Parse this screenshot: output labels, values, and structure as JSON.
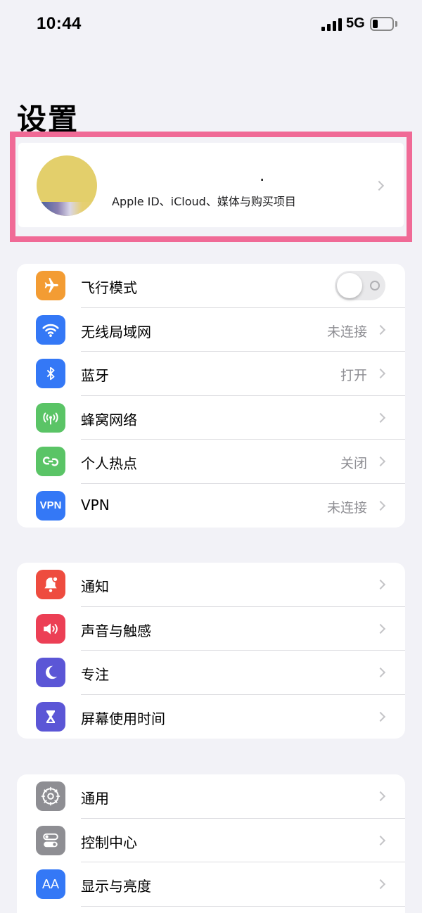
{
  "status_bar": {
    "time": "10:44",
    "network": "5G",
    "battery_level": 0.25
  },
  "page": {
    "title": "设置"
  },
  "profile": {
    "name": ".",
    "subtitle": "Apple ID、iCloud、媒体与购买项目"
  },
  "groups": [
    {
      "rows": [
        {
          "icon": "airplane-icon",
          "color": "#f39c33",
          "label": "飞行模式",
          "toggle": false
        },
        {
          "icon": "wifi-icon",
          "color": "#3478f6",
          "label": "无线局域网",
          "value": "未连接"
        },
        {
          "icon": "bluetooth-icon",
          "color": "#3478f6",
          "label": "蓝牙",
          "value": "打开"
        },
        {
          "icon": "cellular-icon",
          "color": "#5ac466",
          "label": "蜂窝网络",
          "value": ""
        },
        {
          "icon": "hotspot-icon",
          "color": "#5ac466",
          "label": "个人热点",
          "value": "关闭"
        },
        {
          "icon": "vpn-icon",
          "color": "#3478f6",
          "label": "VPN",
          "value": "未连接"
        }
      ]
    },
    {
      "rows": [
        {
          "icon": "notification-icon",
          "color": "#ee4c3f",
          "label": "通知",
          "value": ""
        },
        {
          "icon": "sound-icon",
          "color": "#ec3f55",
          "label": "声音与触感",
          "value": ""
        },
        {
          "icon": "moon-icon",
          "color": "#5b56d6",
          "label": "专注",
          "value": ""
        },
        {
          "icon": "hourglass-icon",
          "color": "#5b56d6",
          "label": "屏幕使用时间",
          "value": ""
        }
      ]
    },
    {
      "rows": [
        {
          "icon": "gear-icon",
          "color": "#8e8e93",
          "label": "通用",
          "value": ""
        },
        {
          "icon": "control-center-icon",
          "color": "#8e8e93",
          "label": "控制中心",
          "value": ""
        },
        {
          "icon": "display-icon",
          "color": "#3478f6",
          "label": "显示与亮度",
          "value": ""
        }
      ]
    }
  ],
  "icon_text": {
    "vpn": "VPN",
    "display": "AA"
  }
}
